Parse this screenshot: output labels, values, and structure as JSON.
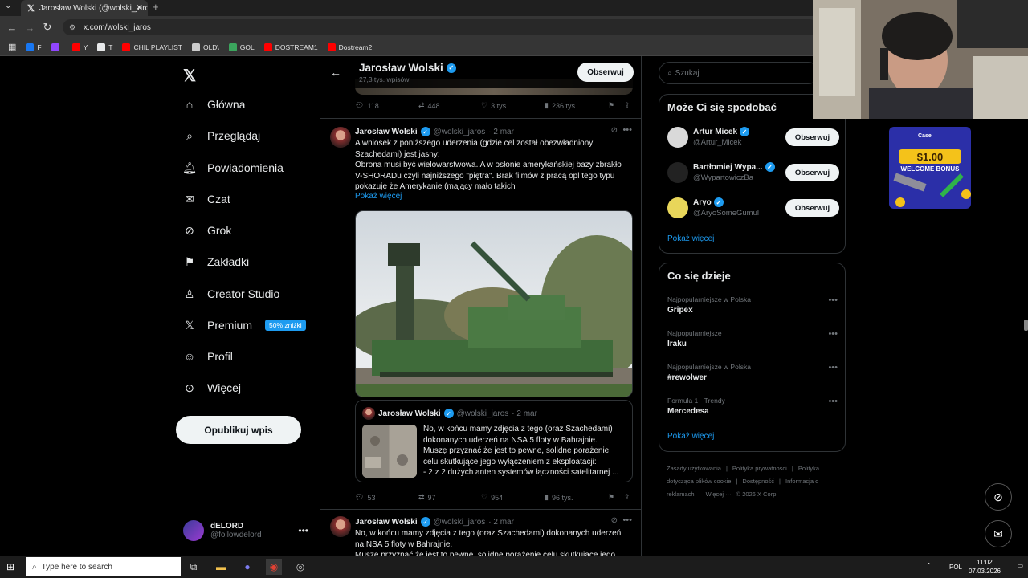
{
  "browser": {
    "tab_title": "Jarosław Wolski (@wolski_jaros",
    "url": "x.com/wolski_jaros",
    "bookmarks": [
      {
        "label": "F",
        "color": "#1877f2"
      },
      {
        "label": "",
        "color": "#9146ff"
      },
      {
        "label": "Y",
        "color": "#ff0000"
      },
      {
        "label": "T",
        "color": "#e7e9ea"
      },
      {
        "label": "CHIL PLAYLIST",
        "color": "#ff0000"
      },
      {
        "label": "OLD\\",
        "color": "#cccccc"
      },
      {
        "label": "GOL",
        "color": "#3ba55d"
      },
      {
        "label": "DOSTREAM1",
        "color": "#ff0000"
      },
      {
        "label": "Dostream2",
        "color": "#ff0000"
      }
    ]
  },
  "nav": {
    "items": [
      {
        "label": "Główna",
        "icon": "home-icon"
      },
      {
        "label": "Przeglądaj",
        "icon": "search-icon"
      },
      {
        "label": "Powiadomienia",
        "icon": "bell-icon"
      },
      {
        "label": "Czat",
        "icon": "mail-icon"
      },
      {
        "label": "Grok",
        "icon": "grok-icon"
      },
      {
        "label": "Zakładki",
        "icon": "bookmark-icon"
      },
      {
        "label": "Creator Studio",
        "icon": "creator-icon"
      },
      {
        "label": "Premium",
        "icon": "x-icon"
      },
      {
        "label": "Profil",
        "icon": "user-icon"
      },
      {
        "label": "Więcej",
        "icon": "more-circle-icon"
      }
    ],
    "premium_badge": "50% zniżki",
    "publish": "Opublikuj wpis",
    "account": {
      "name": "dELORD",
      "handle": "@followdelord"
    }
  },
  "profile_header": {
    "name": "Jarosław Wolski",
    "posts": "27,3 tys. wpisów",
    "follow": "Obserwuj"
  },
  "tweet_prev_stats": {
    "replies": "118",
    "reposts": "448",
    "likes": "3 tys.",
    "views": "236 tys."
  },
  "tweet1": {
    "name": "Jarosław Wolski",
    "handle": "@wolski_jaros",
    "date": "· 2 mar",
    "text_lines": [
      "A wniosek z poniższego uderzenia (gdzie cel został obezwładniony",
      "Szachedami) jest jasny:",
      "Obrona musi być wielowarstwowa. A w osłonie amerykańskiej bazy zbrakło",
      "V-SHORADu czyli najniższego \"piętra\". Brak filmów z pracą opl tego typu",
      "pokazuje że Amerykanie  (mający mało takich"
    ],
    "show_more": "Pokaż więcej",
    "quote": {
      "name": "Jarosław Wolski",
      "handle": "@wolski_jaros",
      "date": "· 2 mar",
      "text_lines": [
        "No, w końcu mamy zdjęcia z tego (oraz Szachedami)",
        "dokonanych uderzeń na NSA 5 floty w Bahrajnie.",
        "Muszę przyznać że jest to pewne, solidne porażenie",
        "celu skutkujące jego wyłączeniem z eksploatacji:",
        "- 2 z 2 dużych anten systemów łączności satelitarnej ..."
      ]
    },
    "stats": {
      "replies": "53",
      "reposts": "97",
      "likes": "954",
      "views": "96 tys."
    }
  },
  "tweet2": {
    "name": "Jarosław Wolski",
    "handle": "@wolski_jaros",
    "date": "· 2 mar",
    "text_lines": [
      "No, w końcu mamy zdjęcia z tego (oraz Szachedami) dokonanych uderzeń",
      "na NSA 5 floty w Bahrajnie.",
      "Muszę przyznać że jest to pewne, solidne porażenie celu skutkujące jego"
    ]
  },
  "sidebar": {
    "search_placeholder": "Szukaj",
    "who_to_follow": {
      "title": "Może Ci się spodobać",
      "users": [
        {
          "name": "Artur Micek",
          "handle": "@Artur_Micek",
          "button": "Obserwuj",
          "color": "#d9d9d9"
        },
        {
          "name": "Bartłomiej Wypa...",
          "handle": "@WypartowiczBa",
          "button": "Obserwuj",
          "color": "#222222"
        },
        {
          "name": "Aryo",
          "handle": "@AryoSomeGumul",
          "button": "Obserwuj",
          "color": "#e8d65a"
        }
      ],
      "show_more": "Pokaż więcej"
    },
    "trends": {
      "title": "Co się dzieje",
      "items": [
        {
          "context": "Najpopularniejsze w Polska",
          "title": "Gripex"
        },
        {
          "context": "Najpopularniejsze",
          "title": "Iraku"
        },
        {
          "context": "Najpopularniejsze w Polska",
          "title": "#rewolwer"
        },
        {
          "context": "Formuła 1 · Trendy",
          "title": "Mercedesa"
        }
      ],
      "show_more": "Pokaż więcej"
    },
    "footer": [
      "Zasady użytkowania",
      "|",
      "Polityka prywatności",
      "|",
      "Polityka dotycząca plików cookie",
      "|",
      "Dostępność",
      "|",
      "Informacja o reklamach",
      "|",
      "Więcej ···",
      "© 2026 X Corp."
    ]
  },
  "ad": {
    "brand": "Case",
    "amount": "$1.00",
    "text": "WELCOME BONUS"
  },
  "taskbar": {
    "search_placeholder": "Type here to search",
    "language": "POL",
    "time": "11:02",
    "date": "07.03.2026"
  }
}
